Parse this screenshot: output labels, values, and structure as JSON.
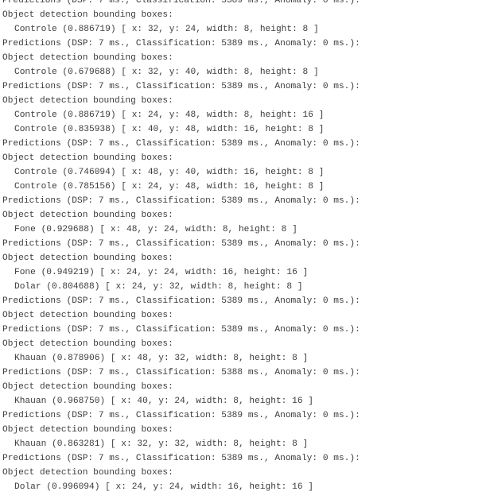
{
  "serial_output": {
    "lines": [
      {
        "text": "Predictions (DSP: 7 ms., Classification: 5389 ms., Anomaly: 0 ms.):",
        "indent": false
      },
      {
        "text": "Object detection bounding boxes:",
        "indent": false
      },
      {
        "text": "Controle (0.886719) [ x: 32, y: 24, width: 8, height: 8 ]",
        "indent": true
      },
      {
        "text": "Predictions (DSP: 7 ms., Classification: 5389 ms., Anomaly: 0 ms.):",
        "indent": false
      },
      {
        "text": "Object detection bounding boxes:",
        "indent": false
      },
      {
        "text": "Controle (0.679688) [ x: 32, y: 40, width: 8, height: 8 ]",
        "indent": true
      },
      {
        "text": "Predictions (DSP: 7 ms., Classification: 5389 ms., Anomaly: 0 ms.):",
        "indent": false
      },
      {
        "text": "Object detection bounding boxes:",
        "indent": false
      },
      {
        "text": "Controle (0.886719) [ x: 24, y: 48, width: 8, height: 16 ]",
        "indent": true
      },
      {
        "text": "Controle (0.835938) [ x: 40, y: 48, width: 16, height: 8 ]",
        "indent": true
      },
      {
        "text": "Predictions (DSP: 7 ms., Classification: 5389 ms., Anomaly: 0 ms.):",
        "indent": false
      },
      {
        "text": "Object detection bounding boxes:",
        "indent": false
      },
      {
        "text": "Controle (0.746094) [ x: 48, y: 40, width: 16, height: 8 ]",
        "indent": true
      },
      {
        "text": "Controle (0.785156) [ x: 24, y: 48, width: 16, height: 8 ]",
        "indent": true
      },
      {
        "text": "Predictions (DSP: 7 ms., Classification: 5389 ms., Anomaly: 0 ms.):",
        "indent": false
      },
      {
        "text": "Object detection bounding boxes:",
        "indent": false
      },
      {
        "text": "Fone (0.929688) [ x: 48, y: 24, width: 8, height: 8 ]",
        "indent": true
      },
      {
        "text": "Predictions (DSP: 7 ms., Classification: 5389 ms., Anomaly: 0 ms.):",
        "indent": false
      },
      {
        "text": "Object detection bounding boxes:",
        "indent": false
      },
      {
        "text": "Fone (0.949219) [ x: 24, y: 24, width: 16, height: 16 ]",
        "indent": true
      },
      {
        "text": "Dolar (0.804688) [ x: 24, y: 32, width: 8, height: 8 ]",
        "indent": true
      },
      {
        "text": "Predictions (DSP: 7 ms., Classification: 5389 ms., Anomaly: 0 ms.):",
        "indent": false
      },
      {
        "text": "Object detection bounding boxes:",
        "indent": false
      },
      {
        "text": "Predictions (DSP: 7 ms., Classification: 5389 ms., Anomaly: 0 ms.):",
        "indent": false
      },
      {
        "text": "Object detection bounding boxes:",
        "indent": false
      },
      {
        "text": "Khauan (0.878906) [ x: 48, y: 32, width: 8, height: 8 ]",
        "indent": true
      },
      {
        "text": "Predictions (DSP: 7 ms., Classification: 5388 ms., Anomaly: 0 ms.):",
        "indent": false
      },
      {
        "text": "Object detection bounding boxes:",
        "indent": false
      },
      {
        "text": "Khauan (0.968750) [ x: 40, y: 24, width: 8, height: 16 ]",
        "indent": true
      },
      {
        "text": "Predictions (DSP: 7 ms., Classification: 5389 ms., Anomaly: 0 ms.):",
        "indent": false
      },
      {
        "text": "Object detection bounding boxes:",
        "indent": false
      },
      {
        "text": "Khauan (0.863281) [ x: 32, y: 32, width: 8, height: 8 ]",
        "indent": true
      },
      {
        "text": "Predictions (DSP: 7 ms., Classification: 5389 ms., Anomaly: 0 ms.):",
        "indent": false
      },
      {
        "text": "Object detection bounding boxes:",
        "indent": false
      },
      {
        "text": "Dolar (0.996094) [ x: 24, y: 24, width: 16, height: 16 ]",
        "indent": true
      }
    ]
  }
}
